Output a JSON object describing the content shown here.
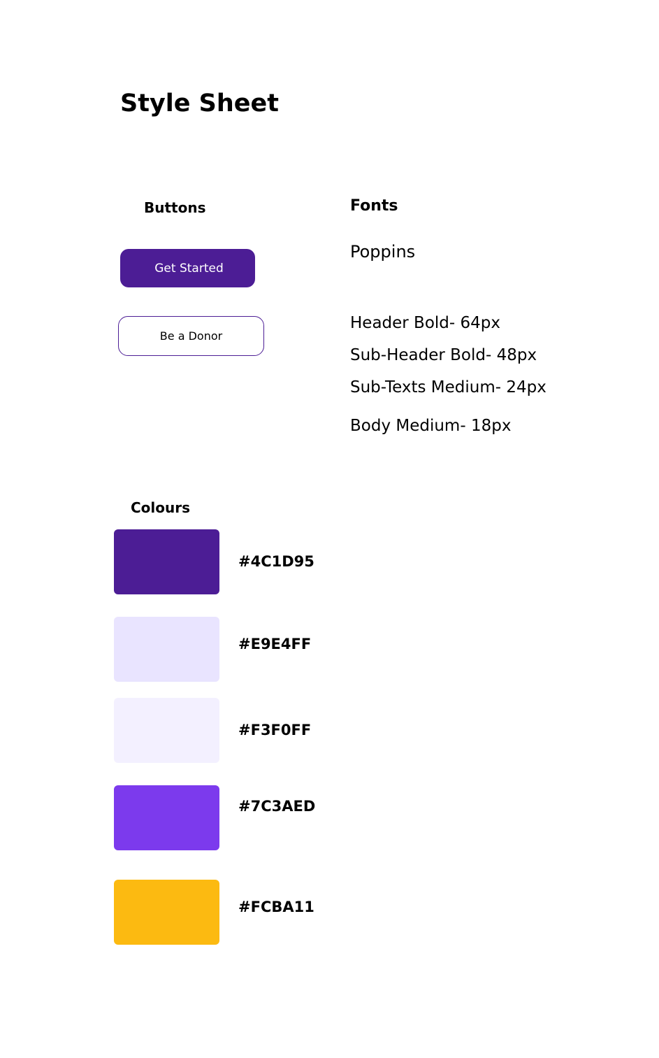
{
  "page": {
    "title": "Style Sheet"
  },
  "buttons_section": {
    "heading": "Buttons",
    "primary_label": "Get Started",
    "secondary_label": "Be a Donor"
  },
  "fonts_section": {
    "heading": "Fonts",
    "family": "Poppins",
    "specs": [
      "Header Bold- 64px",
      "Sub-Header  Bold- 48px",
      "Sub-Texts  Medium- 24px",
      "Body  Medium- 18px"
    ]
  },
  "colours_section": {
    "heading": "Colours",
    "swatches": [
      {
        "label": "#4C1D95",
        "color": "#4c1d95"
      },
      {
        "label": "#E9E4FF",
        "color": "#e9e4ff"
      },
      {
        "label": "#F3F0FF",
        "color": "#f3f0ff"
      },
      {
        "label": "#7C3AED",
        "color": "#7c3aed"
      },
      {
        "label": "#FCBA11",
        "color": "#fcba11"
      }
    ]
  }
}
